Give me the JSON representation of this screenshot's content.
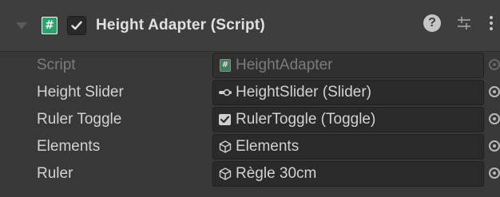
{
  "component": {
    "title": "Height Adapter (Script)",
    "script_glyph": "#",
    "help_glyph": "?",
    "icons": {
      "foldout": "foldout-arrow-icon",
      "script": "script-icon",
      "enabled_checkbox": "checkbox-checked-icon",
      "help": "help-icon",
      "presets": "presets-icon",
      "menu": "kebab-menu-icon"
    }
  },
  "fields": [
    {
      "label": "Script",
      "value": "HeightAdapter",
      "icon": "script-icon",
      "disabled": true
    },
    {
      "label": "Height Slider",
      "value": "HeightSlider (Slider)",
      "icon": "slider-icon",
      "disabled": false
    },
    {
      "label": "Ruler Toggle",
      "value": "RulerToggle (Toggle)",
      "icon": "toggle-icon",
      "disabled": false
    },
    {
      "label": "Elements",
      "value": "Elements",
      "icon": "gameobject-icon",
      "disabled": false
    },
    {
      "label": "Ruler",
      "value": "Règle 30cm",
      "icon": "gameobject-icon",
      "disabled": false
    }
  ],
  "colors": {
    "background": "#383838",
    "header": "#3e3e3e",
    "field_bg": "#2a2a2a",
    "text": "#d2d2d2",
    "disabled_text": "#7b7b7b",
    "script_icon_green": "#2aa56a"
  }
}
